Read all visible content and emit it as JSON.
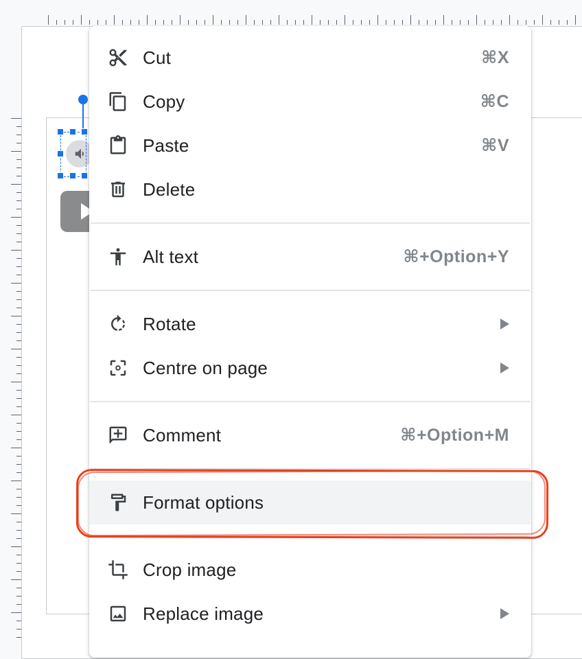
{
  "context_menu": {
    "items": [
      {
        "label": "Cut",
        "shortcut": "⌘X",
        "icon": "scissors-icon"
      },
      {
        "label": "Copy",
        "shortcut": "⌘C",
        "icon": "copy-icon"
      },
      {
        "label": "Paste",
        "shortcut": "⌘V",
        "icon": "clipboard-icon"
      },
      {
        "label": "Delete",
        "shortcut": "",
        "icon": "trash-icon"
      },
      {
        "label": "Alt text",
        "shortcut": "⌘+Option+Y",
        "icon": "accessibility-icon"
      },
      {
        "label": "Rotate",
        "shortcut": "",
        "icon": "rotate-icon",
        "submenu": true
      },
      {
        "label": "Centre on page",
        "shortcut": "",
        "icon": "center-focus-icon",
        "submenu": true
      },
      {
        "label": "Comment",
        "shortcut": "⌘+Option+M",
        "icon": "add-comment-icon"
      },
      {
        "label": "Format options",
        "shortcut": "",
        "icon": "paint-roller-icon",
        "highlighted": true
      },
      {
        "label": "Crop image",
        "shortcut": "",
        "icon": "crop-icon"
      },
      {
        "label": "Replace image",
        "shortcut": "",
        "icon": "image-icon",
        "submenu": true
      }
    ]
  },
  "canvas": {
    "selected_object": "audio",
    "play_button_icon": "play-icon",
    "speaker_icon": "speaker-icon"
  },
  "colors": {
    "selection": "#1a73e8",
    "annotation": "#e8401c",
    "highlight": "#f1f3f4",
    "shortcut_text": "#80868b"
  }
}
